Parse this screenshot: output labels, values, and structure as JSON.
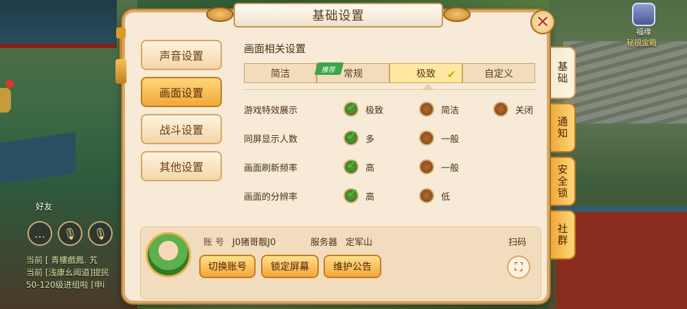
{
  "dialog": {
    "title": "基础设置",
    "close_icon": "close-icon"
  },
  "menu": [
    {
      "label": "声音设置",
      "active": false
    },
    {
      "label": "画面设置",
      "active": true
    },
    {
      "label": "战斗设置",
      "active": false
    },
    {
      "label": "其他设置",
      "active": false
    }
  ],
  "graphics": {
    "section_title": "画面相关设置",
    "quality_tabs": [
      {
        "label": "简洁",
        "badge": "",
        "selected": false
      },
      {
        "label": "常规",
        "badge": "推荐",
        "selected": false
      },
      {
        "label": "极致",
        "badge": "",
        "selected": true
      },
      {
        "label": "自定义",
        "badge": "",
        "selected": false
      }
    ],
    "settings": [
      {
        "label": "游戏特效展示",
        "options": [
          "极致",
          "简洁",
          "关闭"
        ],
        "selected": 0
      },
      {
        "label": "同屏显示人数",
        "options": [
          "多",
          "一般"
        ],
        "selected": 0
      },
      {
        "label": "画面刷新频率",
        "options": [
          "高",
          "一般"
        ],
        "selected": 0
      },
      {
        "label": "画面的分辨率",
        "options": [
          "高",
          "低"
        ],
        "selected": 0
      }
    ]
  },
  "account": {
    "account_key": "账 号",
    "account_value": "J0猪哥靓J0",
    "server_key": "服务器",
    "server_value": "定军山",
    "scan_label": "扫码",
    "buttons": [
      "切换账号",
      "锁定屏幕",
      "维护公告"
    ]
  },
  "side_tabs": [
    {
      "label": "基础",
      "active": true
    },
    {
      "label": "通知",
      "active": false
    },
    {
      "label": "安全锁",
      "active": false
    },
    {
      "label": "社群",
      "active": false
    }
  ],
  "background": {
    "friend_label": "好友",
    "top_icon_line1": "福缘",
    "top_icon_line2": "秘银宝箱",
    "chat_lines": [
      "当前 [ 青樓戲鳳. 艽",
      "当前 [浅康幺闻道]提民",
      "50-120级进组啦 [申i"
    ]
  },
  "colors": {
    "accent_orange": "#f0a93a",
    "panel_bg": "#f7ead6",
    "close_red": "#d22a1f",
    "check_green": "#36c23a",
    "badge_green": "#39a64a"
  }
}
